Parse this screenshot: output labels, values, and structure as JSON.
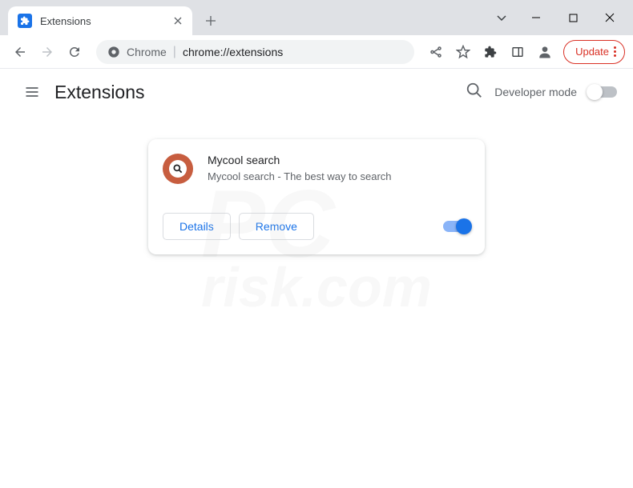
{
  "tab": {
    "title": "Extensions"
  },
  "omnibox": {
    "chip": "Chrome",
    "url": "chrome://extensions"
  },
  "toolbar": {
    "update": "Update"
  },
  "page": {
    "title": "Extensions",
    "devmode_label": "Developer mode"
  },
  "extension": {
    "name": "Mycool search",
    "description": "Mycool search - The best way to search",
    "details_label": "Details",
    "remove_label": "Remove"
  }
}
